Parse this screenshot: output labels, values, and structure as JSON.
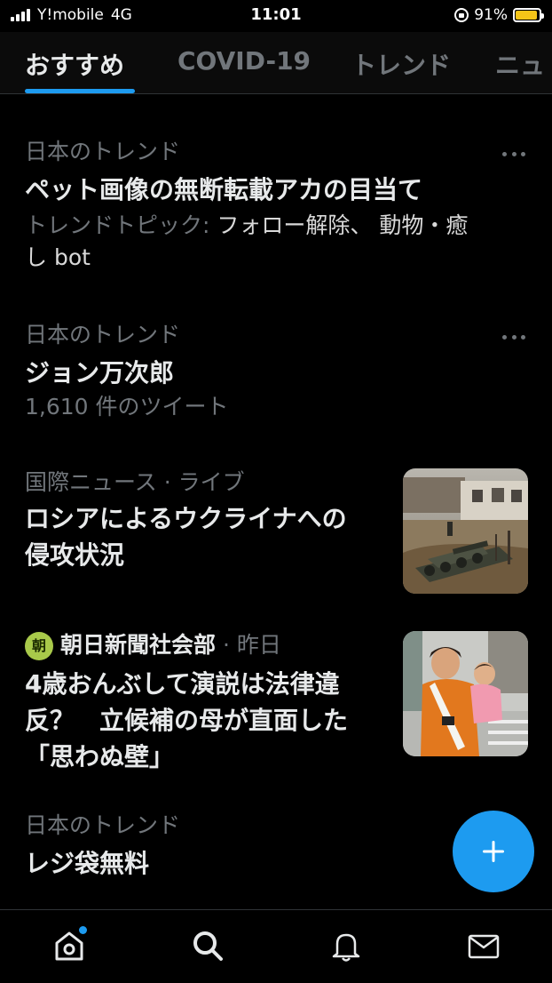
{
  "status_bar": {
    "carrier": "Y!mobile",
    "network": "4G",
    "time": "11:01",
    "battery": "91%",
    "battery_level": 0.91
  },
  "tabs": [
    {
      "label": "おすすめ",
      "active": true
    },
    {
      "label": "COVID-19",
      "active": false
    },
    {
      "label": "トレンド",
      "active": false
    },
    {
      "label": "ニュ",
      "active": false
    }
  ],
  "feed": [
    {
      "category": "日本のトレンド",
      "title": "ペット画像の無断転載アカの目当て",
      "trend_prefix": "トレンドトピック: ",
      "trend_topics": "フォロー解除、 動物・癒",
      "trend_topics_cont": "し bot"
    },
    {
      "category": "日本のトレンド",
      "title": "ジョン万次郎",
      "tweet_count": "1,610 件のツイート"
    },
    {
      "category": "国際ニュース",
      "status": "· ライブ",
      "title_line1": "ロシアによるウクライナへの",
      "title_line2": "侵攻状況"
    },
    {
      "source_logo": "朝",
      "source": "朝日新聞社会部",
      "time": "· 昨日",
      "title_line1": "4歳おんぶして演説は法律違",
      "title_line2": "反？　立候補の母が直面した",
      "title_line3": "「思わぬ壁」"
    },
    {
      "category": "日本のトレンド",
      "title": "レジ袋無料"
    }
  ],
  "icons": {
    "home": "home-icon",
    "search": "search-icon",
    "notifications": "bell-icon",
    "messages": "mail-icon",
    "compose": "plus-icon",
    "more": "more-icon"
  },
  "colors": {
    "accent": "#1d9bf0",
    "background": "#000000",
    "muted_text": "#71767b",
    "battery": "#f5c518"
  }
}
